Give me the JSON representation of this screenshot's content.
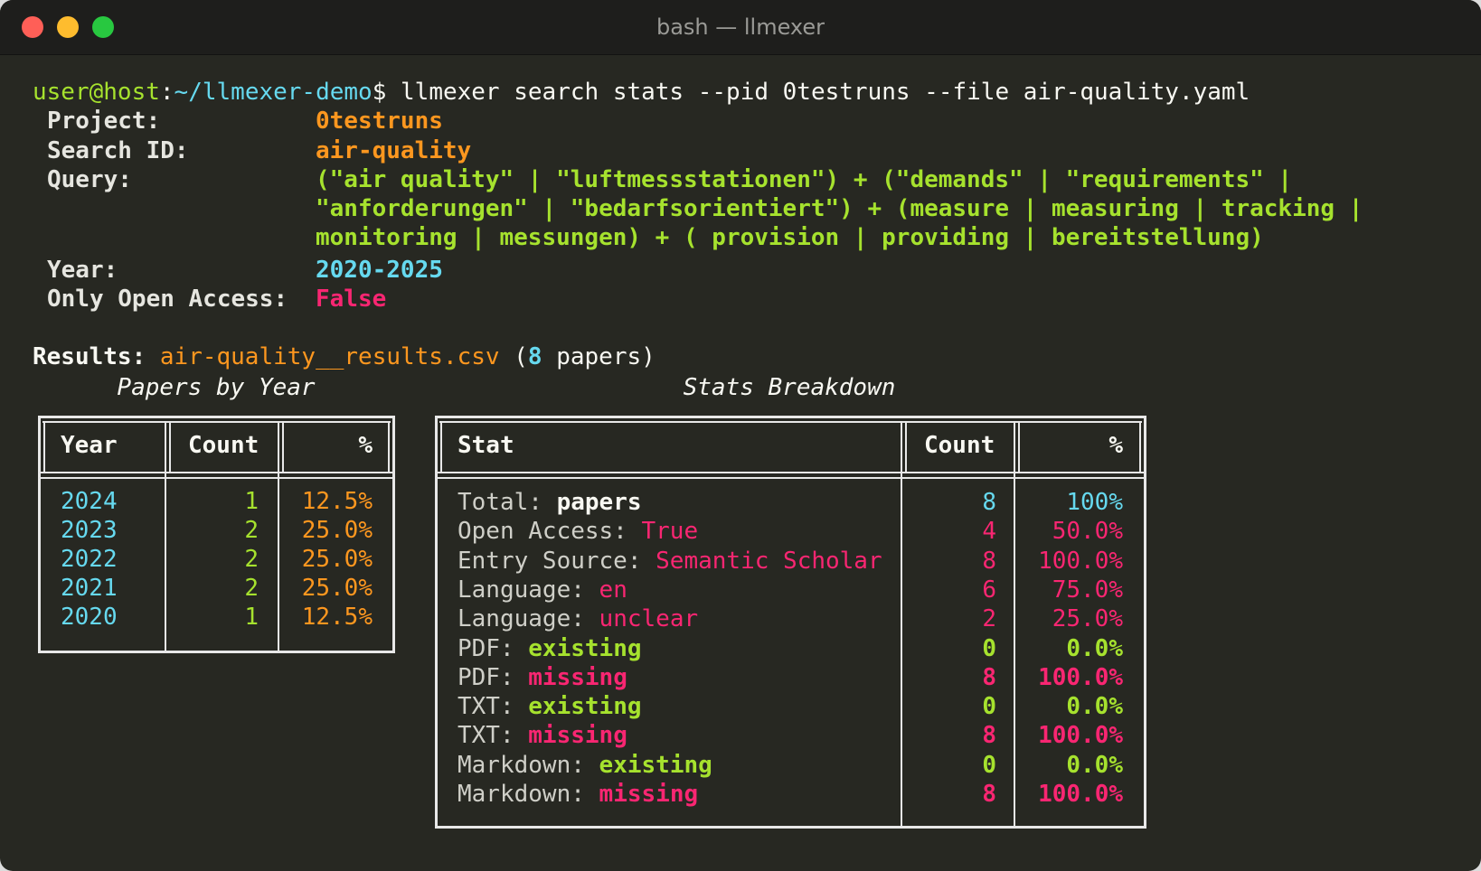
{
  "window": {
    "title": "bash — llmexer"
  },
  "prompt": {
    "user_host": "user@host",
    "colon": ":",
    "path": "~/llmexer-demo",
    "dollar": "$",
    "command": " llmexer search stats --pid 0testruns --file air-quality.yaml"
  },
  "info": {
    "project_label": "Project:",
    "project_value": "0testruns",
    "search_id_label": "Search ID:",
    "search_id_value": "air-quality",
    "query_label": "Query:",
    "query_lines": [
      "(\"air quality\" | \"luftmessstationen\") + (\"demands\" | \"requirements\" |",
      "\"anforderungen\" | \"bedarfsorientiert\") + (measure | measuring | tracking |",
      "monitoring | messungen) + ( provision | providing | bereitstellung)"
    ],
    "year_label": "Year:",
    "year_value": "2020-2025",
    "open_access_label": "Only Open Access:",
    "open_access_value": "False"
  },
  "results": {
    "label": "Results:",
    "file": "air-quality__results.csv",
    "paren_open": " (",
    "count": "8",
    "papers_suffix": " papers)"
  },
  "papers_by_year": {
    "title": "Papers by Year",
    "headers": [
      "Year",
      "Count",
      "%"
    ],
    "rows": [
      {
        "year": "2024",
        "count": "1",
        "pct": "12.5%"
      },
      {
        "year": "2023",
        "count": "2",
        "pct": "25.0%"
      },
      {
        "year": "2022",
        "count": "2",
        "pct": "25.0%"
      },
      {
        "year": "2021",
        "count": "2",
        "pct": "25.0%"
      },
      {
        "year": "2020",
        "count": "1",
        "pct": "12.5%"
      }
    ]
  },
  "stats_breakdown": {
    "title": "Stats Breakdown",
    "headers": [
      "Stat",
      "Count",
      "%"
    ],
    "rows": [
      {
        "key": "Total: ",
        "value": "papers",
        "count": "8",
        "pct": "100%",
        "style": "total"
      },
      {
        "key": "Open Access: ",
        "value": "True",
        "count": "4",
        "pct": "50.0%",
        "style": "pink"
      },
      {
        "key": "Entry Source: ",
        "value": "Semantic Scholar",
        "count": "8",
        "pct": "100.0%",
        "style": "pink"
      },
      {
        "key": "Language: ",
        "value": "en",
        "count": "6",
        "pct": "75.0%",
        "style": "pink"
      },
      {
        "key": "Language: ",
        "value": "unclear",
        "count": "2",
        "pct": "25.0%",
        "style": "pink"
      },
      {
        "key": "PDF: ",
        "value": "existing",
        "count": "0",
        "pct": "0.0%",
        "style": "green-bold"
      },
      {
        "key": "PDF: ",
        "value": "missing",
        "count": "8",
        "pct": "100.0%",
        "style": "pink-bold"
      },
      {
        "key": "TXT: ",
        "value": "existing",
        "count": "0",
        "pct": "0.0%",
        "style": "green-bold"
      },
      {
        "key": "TXT: ",
        "value": "missing",
        "count": "8",
        "pct": "100.0%",
        "style": "pink-bold"
      },
      {
        "key": "Markdown: ",
        "value": "existing",
        "count": "0",
        "pct": "0.0%",
        "style": "green-bold"
      },
      {
        "key": "Markdown: ",
        "value": "missing",
        "count": "8",
        "pct": "100.0%",
        "style": "pink-bold"
      }
    ]
  },
  "colors": {
    "background": "#272822",
    "green": "#a6e22e",
    "cyan": "#66d9ef",
    "orange": "#fd971f",
    "pink": "#f92672",
    "foreground": "#f8f8f2"
  }
}
